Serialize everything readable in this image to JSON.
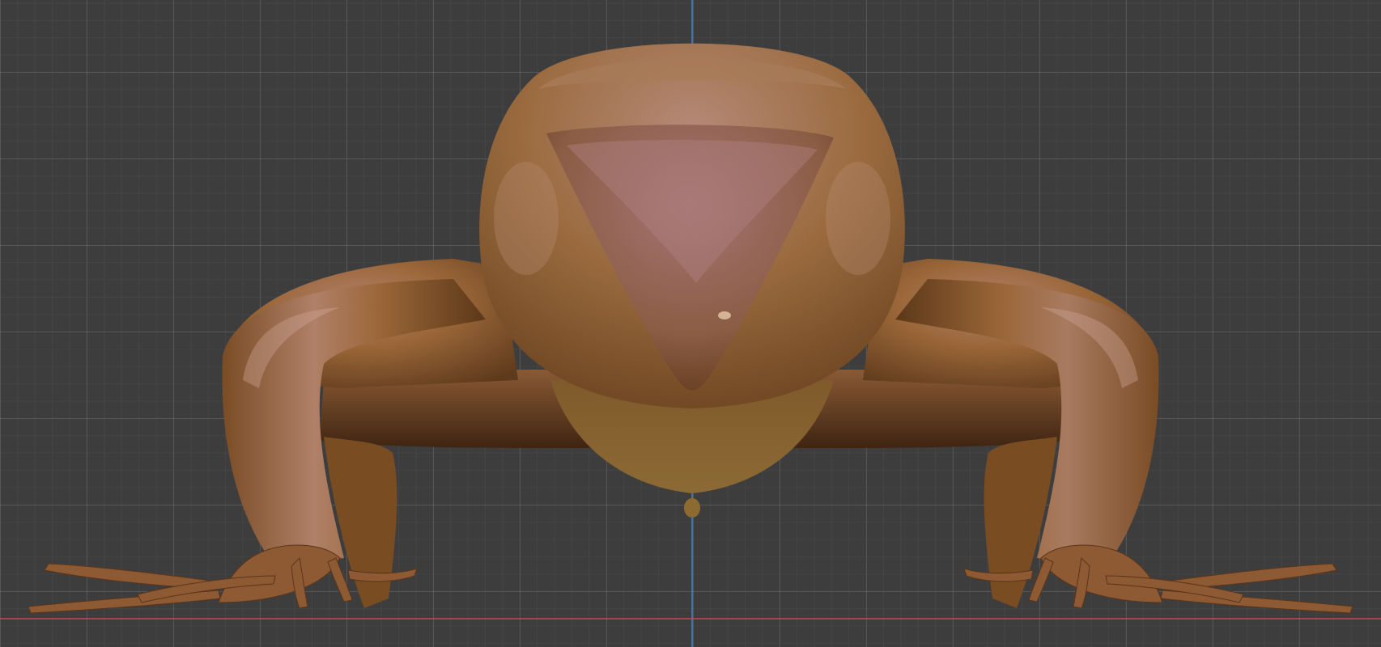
{
  "app": {
    "view": "3d-viewport"
  },
  "viewport": {
    "background_color": "#3d3d3d",
    "grid_major_color": "#555555",
    "grid_minor_color": "#464646",
    "axis_x_color": "#c94459",
    "axis_z_color": "#3a88d6"
  },
  "model": {
    "subject": "frog-sculpt",
    "material_color": "#9a6638",
    "highlight_color": "#c79a86",
    "shadow_color": "#4a2a14"
  }
}
